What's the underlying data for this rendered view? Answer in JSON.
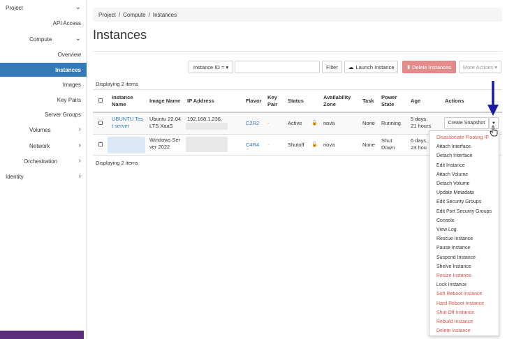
{
  "sidebar": {
    "project": "Project",
    "api_access": "API Access",
    "compute": "Compute",
    "overview": "Overview",
    "instances": "Instances",
    "images": "Images",
    "key_pairs": "Key Pairs",
    "server_groups": "Server Groups",
    "volumes": "Volumes",
    "network": "Network",
    "orchestration": "Orchestration",
    "identity": "Identity"
  },
  "breadcrumb": {
    "project": "Project",
    "compute": "Compute",
    "instances": "Instances",
    "sep": "/"
  },
  "page_title": "Instances",
  "toolbar": {
    "filter_select": "Instance ID = ▾",
    "filter_button": "Filter",
    "launch_button": "Launch Instance",
    "delete_button": "Delete Instances",
    "more_actions": "More Actions ▾"
  },
  "display_count": "Displaying 2 items",
  "table": {
    "headers": {
      "name": [
        "Instance",
        "Name"
      ],
      "image": "Image Name",
      "ip": "IP Address",
      "flavor": "Flavor",
      "key_pair": [
        "Key",
        "Pair"
      ],
      "status": "Status",
      "zone": [
        "Availability",
        "Zone"
      ],
      "task": "Task",
      "power": [
        "Power",
        "State"
      ],
      "age": "Age",
      "actions": "Actions"
    },
    "rows": [
      {
        "name": [
          "UBUNTU Tes",
          "t server"
        ],
        "image": [
          "Ubuntu 22.04",
          "LTS XaaS"
        ],
        "ip": "192.168.1.236,",
        "flavor": "C2R2",
        "key_pair": "-",
        "status": "Active",
        "zone": "nova",
        "task": "None",
        "power": "Running",
        "age": [
          "5 days,",
          "21 hours"
        ],
        "action": "Create Snapshot"
      },
      {
        "image": [
          "Windows Ser",
          "ver 2022"
        ],
        "flavor": "C4R4",
        "key_pair": "-",
        "status": "Shutoff",
        "zone": "nova",
        "task": "None",
        "power": [
          "Shut",
          "Down"
        ],
        "age": [
          "6 days,",
          "23 hou"
        ]
      }
    ]
  },
  "dropdown": [
    {
      "label": "Disassociate Floating IP",
      "danger": true
    },
    {
      "label": "Attach Interface",
      "danger": false
    },
    {
      "label": "Detach Interface",
      "danger": false
    },
    {
      "label": "Edit Instance",
      "danger": false
    },
    {
      "label": "Attach Volume",
      "danger": false
    },
    {
      "label": "Detach Volume",
      "danger": false
    },
    {
      "label": "Update Metadata",
      "danger": false
    },
    {
      "label": "Edit Security Groups",
      "danger": false
    },
    {
      "label": "Edit Port Security Groups",
      "danger": false
    },
    {
      "label": "Console",
      "danger": false
    },
    {
      "label": "View Log",
      "danger": false
    },
    {
      "label": "Rescue Instance",
      "danger": false
    },
    {
      "label": "Pause Instance",
      "danger": false
    },
    {
      "label": "Suspend Instance",
      "danger": false
    },
    {
      "label": "Shelve Instance",
      "danger": false
    },
    {
      "label": "Resize Instance",
      "danger": true
    },
    {
      "label": "Lock Instance",
      "danger": false
    },
    {
      "label": "Soft Reboot Instance",
      "danger": true
    },
    {
      "label": "Hard Reboot Instance",
      "danger": true
    },
    {
      "label": "Shut Off Instance",
      "danger": true
    },
    {
      "label": "Rebuild Instance",
      "danger": true
    },
    {
      "label": "Delete Instance",
      "danger": true
    }
  ],
  "colors": {
    "accent": "#337ab7",
    "danger": "#d9534f",
    "danger_button": "#e48c8c",
    "annotation_arrow": "#1a1aa6"
  },
  "icons": {
    "chevron_down": "chevron-down-icon",
    "chevron_right": "chevron-right-icon",
    "upload": "upload-icon",
    "trash": "trash-icon",
    "lock": "lock-icon",
    "caret": "caret-down-icon"
  }
}
